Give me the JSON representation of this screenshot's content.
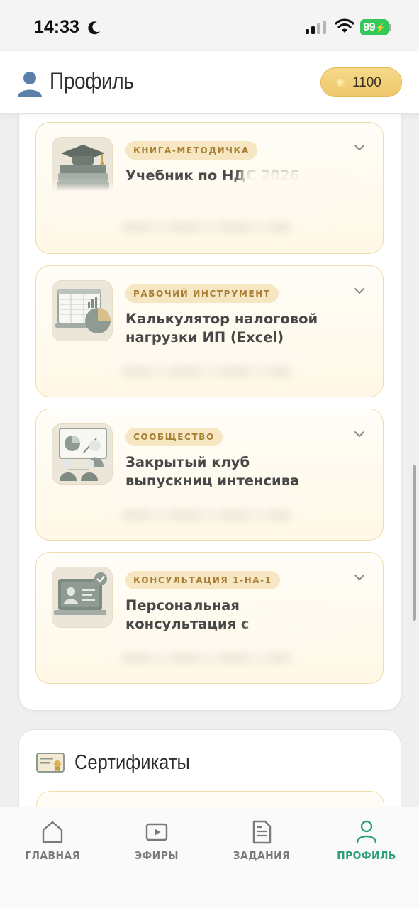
{
  "status_bar": {
    "time": "14:33",
    "battery": "99"
  },
  "header": {
    "title": "Профиль",
    "coins": "1100"
  },
  "products": [
    {
      "tag": "КНИГА-МЕТОДИЧКА",
      "title": "Учебник по НДС 2026",
      "icon": "graduation-cap-book-icon"
    },
    {
      "tag": "РАБОЧИЙ ИНСТРУМЕНТ",
      "title": "Калькулятор налоговой нагрузки ИП (Excel)",
      "icon": "spreadsheet-chart-icon"
    },
    {
      "tag": "СООБЩЕСТВО",
      "title": "Закрытый клуб выпускниц интенсива",
      "icon": "community-presentation-icon"
    },
    {
      "tag": "КОНСУЛЬТАЦИЯ 1-НА-1",
      "title": "Персональная консультация с",
      "icon": "consultation-laptop-icon"
    }
  ],
  "certificates": {
    "title": "Сертификаты",
    "icon": "certificate-icon"
  },
  "nav": [
    {
      "label": "ГЛАВНАЯ",
      "icon": "home-icon",
      "active": false
    },
    {
      "label": "ЭФИРЫ",
      "icon": "play-icon",
      "active": false
    },
    {
      "label": "ЗАДАНИЯ",
      "icon": "document-icon",
      "active": false
    },
    {
      "label": "ПРОФИЛЬ",
      "icon": "user-icon",
      "active": true
    }
  ],
  "colors": {
    "accent": "#2e9f79",
    "tag_text": "#a87e35",
    "coin_pill": "#f2cf78",
    "battery": "#34c759"
  }
}
